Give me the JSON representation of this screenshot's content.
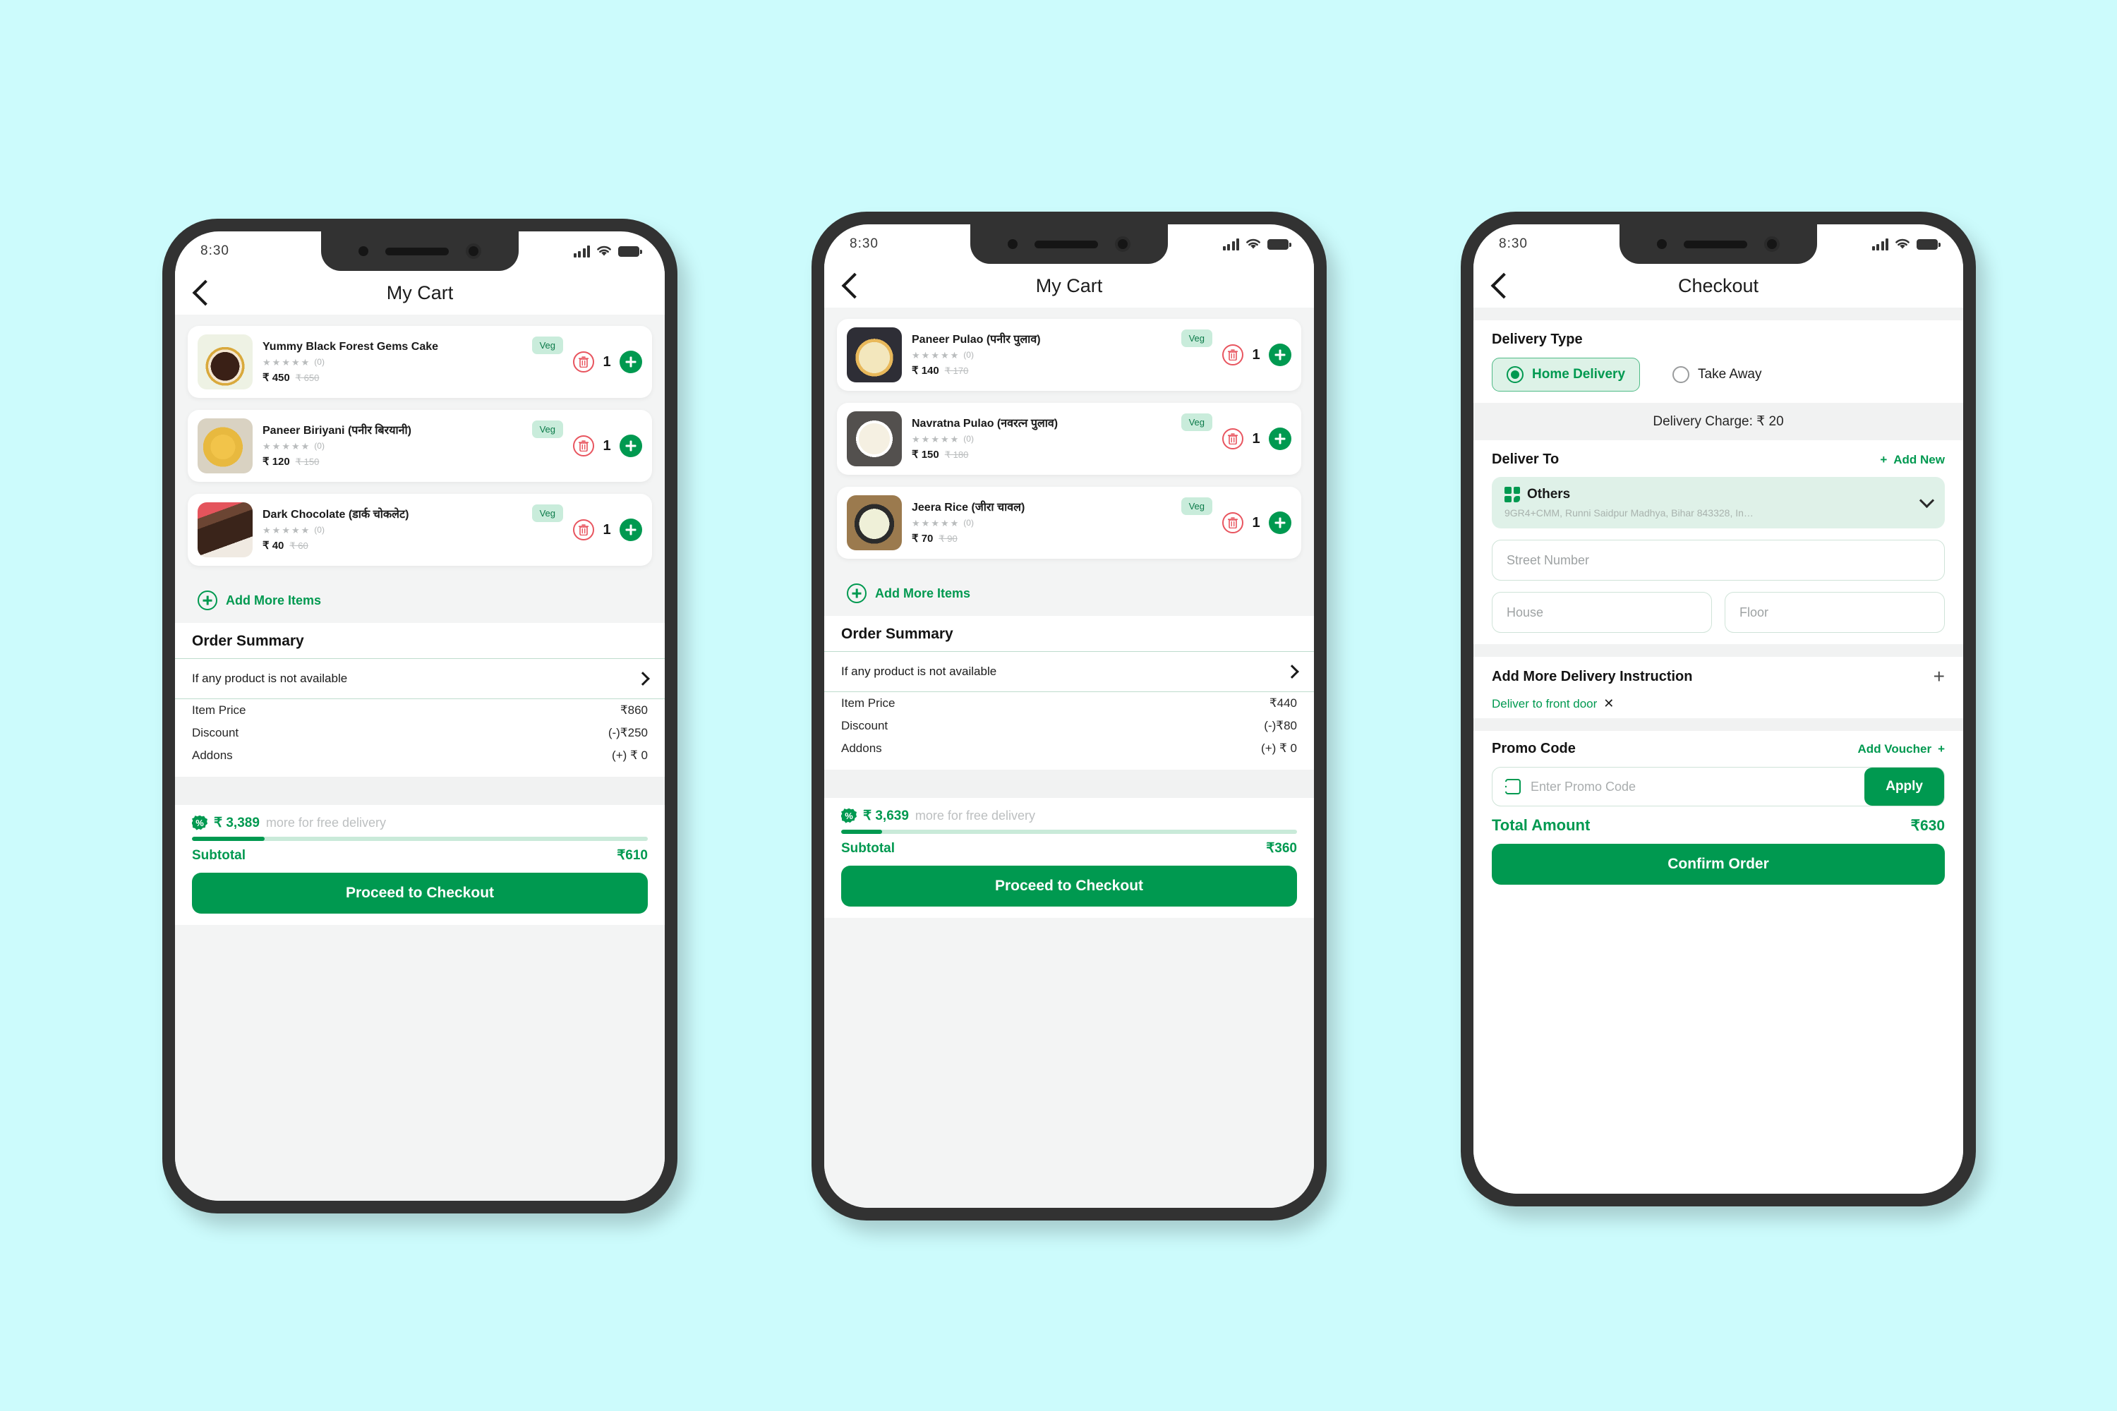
{
  "background_color": "#ccfbfc",
  "accent_green": "#009950",
  "status_bar": {
    "time": "8:30"
  },
  "phones": [
    {
      "id": "cart-1",
      "title": "My Cart",
      "items": [
        {
          "name": "Yummy Black Forest Gems Cake",
          "badge": "Veg",
          "rating_count": "(0)",
          "price": "₹ 450",
          "old_price": "₹ 650",
          "qty": "1",
          "image_kind": "black-forest-cake"
        },
        {
          "name": "Paneer Biriyani (पनीर बिरयानी)",
          "badge": "Veg",
          "rating_count": "(0)",
          "price": "₹ 120",
          "old_price": "₹ 150",
          "qty": "1",
          "image_kind": "biriyani"
        },
        {
          "name": "Dark Chocolate (डार्क चोकलेट)",
          "badge": "Veg",
          "rating_count": "(0)",
          "price": "₹ 40",
          "old_price": "₹ 60",
          "qty": "1",
          "image_kind": "dark-chocolate-cake"
        }
      ],
      "add_more_label": "Add More Items",
      "summary_title": "Order Summary",
      "unavailable_label": "If any product is not available",
      "lines": [
        {
          "label": "Item Price",
          "value": "₹860"
        },
        {
          "label": "Discount",
          "value": "(-)₹250"
        },
        {
          "label": "Addons",
          "value": "(+) ₹ 0"
        }
      ],
      "free_delivery_amount": "₹ 3,389",
      "free_delivery_text": "more for free delivery",
      "progress_percent": 16,
      "subtotal_label": "Subtotal",
      "subtotal_value": "₹610",
      "cta_label": "Proceed to Checkout"
    },
    {
      "id": "cart-2",
      "title": "My Cart",
      "items": [
        {
          "name": "Paneer Pulao (पनीर पुलाव)",
          "badge": "Veg",
          "rating_count": "(0)",
          "price": "₹ 140",
          "old_price": "₹ 170",
          "qty": "1",
          "image_kind": "paneer-pulao"
        },
        {
          "name": "Navratna Pulao (नवरत्न पुलाव)",
          "badge": "Veg",
          "rating_count": "(0)",
          "price": "₹ 150",
          "old_price": "₹ 180",
          "qty": "1",
          "image_kind": "navratna-pulao"
        },
        {
          "name": "Jeera Rice (जीरा चावल)",
          "badge": "Veg",
          "rating_count": "(0)",
          "price": "₹ 70",
          "old_price": "₹ 90",
          "qty": "1",
          "image_kind": "jeera-rice"
        }
      ],
      "add_more_label": "Add More Items",
      "summary_title": "Order Summary",
      "unavailable_label": "If any product is not available",
      "lines": [
        {
          "label": "Item Price",
          "value": "₹440"
        },
        {
          "label": "Discount",
          "value": "(-)₹80"
        },
        {
          "label": "Addons",
          "value": "(+) ₹ 0"
        }
      ],
      "free_delivery_amount": "₹ 3,639",
      "free_delivery_text": "more for free delivery",
      "progress_percent": 9,
      "subtotal_label": "Subtotal",
      "subtotal_value": "₹360",
      "cta_label": "Proceed to Checkout"
    }
  ],
  "checkout": {
    "title": "Checkout",
    "delivery_type_label": "Delivery Type",
    "options": [
      {
        "label": "Home Delivery",
        "selected": true
      },
      {
        "label": "Take Away",
        "selected": false
      }
    ],
    "delivery_charge": "Delivery Charge: ₹ 20",
    "deliver_to_label": "Deliver To",
    "add_new_label": "Add New",
    "address": {
      "title": "Others",
      "detail": "9GR4+CMM, Runni Saidpur Madhya, Bihar 843328, In…"
    },
    "fields": [
      {
        "placeholder": "Street Number"
      },
      {
        "placeholder": "House"
      },
      {
        "placeholder": "Floor"
      }
    ],
    "instruction_label": "Add More Delivery Instruction",
    "instruction_chip": "Deliver to front door",
    "promo_label": "Promo Code",
    "add_voucher_label": "Add Voucher",
    "promo_placeholder": "Enter Promo Code",
    "apply_label": "Apply",
    "total_label": "Total Amount",
    "total_value": "₹630",
    "cta_label": "Confirm Order"
  }
}
